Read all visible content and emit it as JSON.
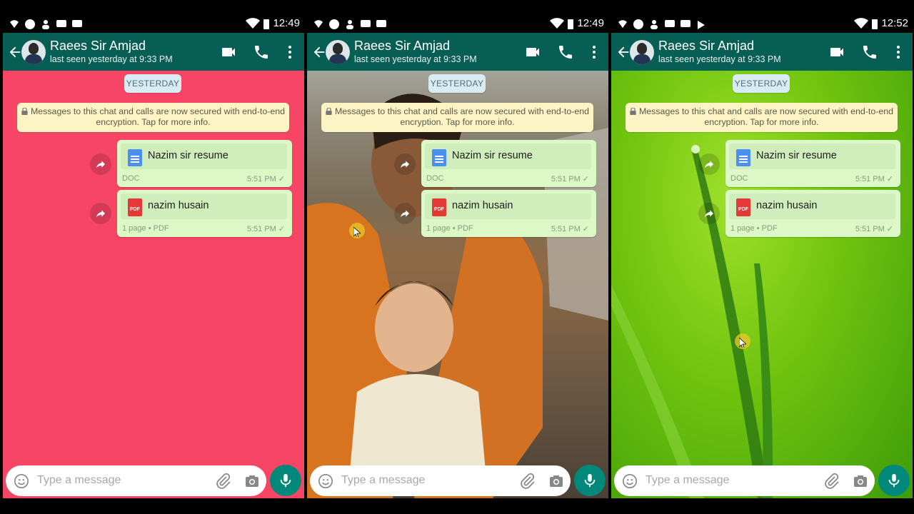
{
  "panels": [
    {
      "status": {
        "time": "12:49"
      },
      "header": {
        "contact_name": "Raees Sir Amjad",
        "last_seen": "last seen yesterday at 9:33 PM"
      },
      "chat": {
        "background": "solid-pink",
        "date_chip": "YESTERDAY",
        "encryption_notice": "Messages to this chat and calls are now secured with end-to-end encryption. Tap for more info.",
        "messages": [
          {
            "type": "doc",
            "file_name": "Nazim sir resume",
            "meta": "DOC",
            "time": "5:51 PM"
          },
          {
            "type": "pdf",
            "file_name": "nazim husain",
            "meta": "1 page • PDF",
            "time": "5:51 PM"
          }
        ]
      },
      "input": {
        "placeholder": "Type a message"
      }
    },
    {
      "status": {
        "time": "12:49"
      },
      "header": {
        "contact_name": "Raees Sir Amjad",
        "last_seen": "last seen yesterday at 9:33 PM"
      },
      "chat": {
        "background": "photo-wallpaper",
        "date_chip": "YESTERDAY",
        "encryption_notice": "Messages to this chat and calls are now secured with end-to-end encryption. Tap for more info.",
        "messages": [
          {
            "type": "doc",
            "file_name": "Nazim sir resume",
            "meta": "DOC",
            "time": "5:51 PM"
          },
          {
            "type": "pdf",
            "file_name": "nazim husain",
            "meta": "1 page • PDF",
            "time": "5:51 PM"
          }
        ]
      },
      "input": {
        "placeholder": "Type a message"
      }
    },
    {
      "status": {
        "time": "12:52"
      },
      "header": {
        "contact_name": "Raees Sir Amjad",
        "last_seen": "last seen yesterday at 9:33 PM"
      },
      "chat": {
        "background": "green-grass-wallpaper",
        "date_chip": "YESTERDAY",
        "encryption_notice": "Messages to this chat and calls are now secured with end-to-end encryption. Tap for more info.",
        "messages": [
          {
            "type": "doc",
            "file_name": "Nazim sir resume",
            "meta": "DOC",
            "time": "5:51 PM"
          },
          {
            "type": "pdf",
            "file_name": "nazim husain",
            "meta": "1 page • PDF",
            "time": "5:51 PM"
          }
        ]
      },
      "input": {
        "placeholder": "Type a message"
      }
    }
  ],
  "colors": {
    "appbar": "#075e54",
    "bubble_out": "#dcf8c6",
    "accent": "#00897b",
    "encryption_bg": "#fdf4c5"
  },
  "icons": [
    "back-arrow-icon",
    "video-call-icon",
    "phone-icon",
    "more-vert-icon",
    "forward-icon",
    "doc-icon",
    "pdf-icon",
    "emoji-icon",
    "attach-icon",
    "camera-icon",
    "mic-icon",
    "lock-icon"
  ]
}
